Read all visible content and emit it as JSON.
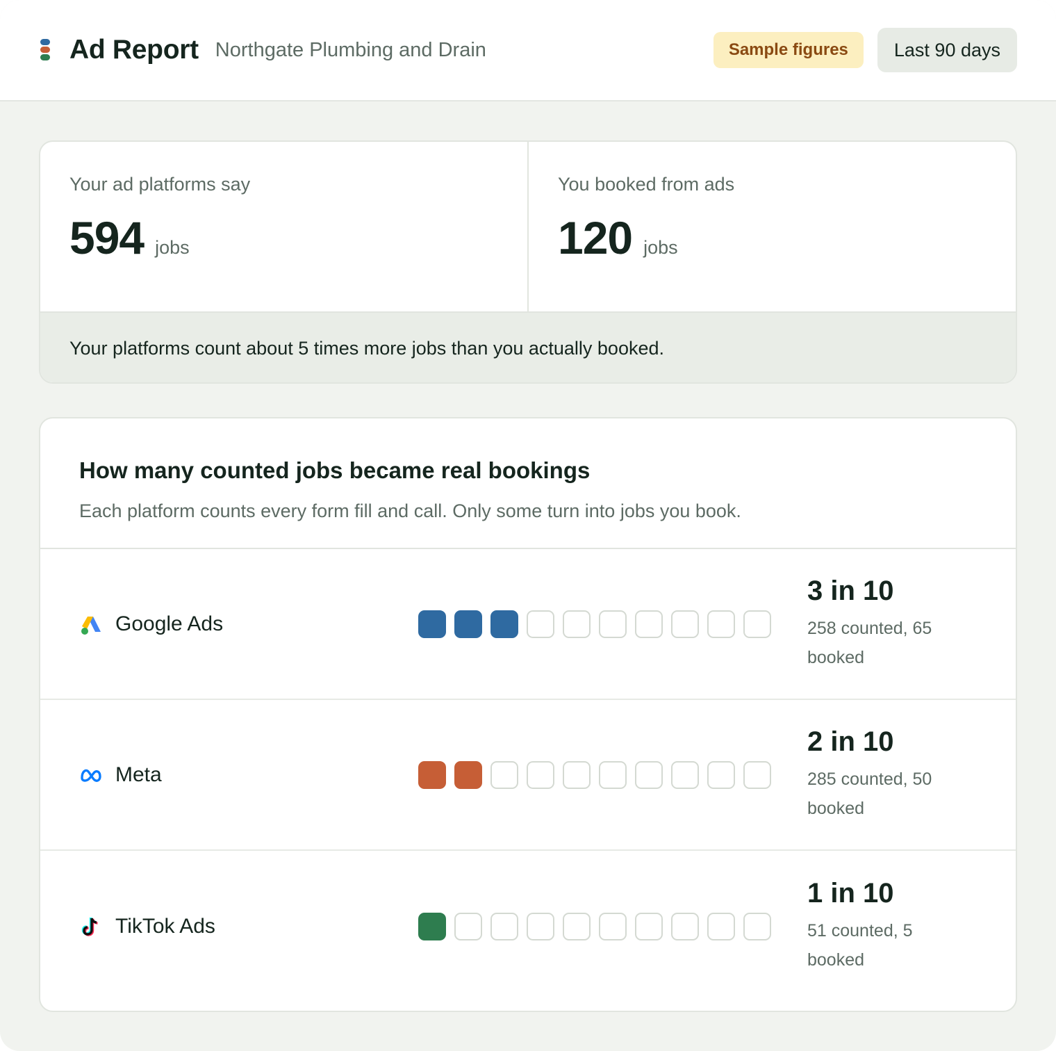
{
  "header": {
    "title": "Ad Report",
    "client": "Northgate Plumbing and Drain",
    "sample_badge": "Sample figures",
    "date_range": "Last 90 days"
  },
  "summary": {
    "platforms_label": "Your ad platforms say",
    "platforms_value": "594",
    "platforms_unit": "jobs",
    "booked_label": "You booked from ads",
    "booked_value": "120",
    "booked_unit": "jobs",
    "note": "Your platforms count about 5 times more jobs than you actually booked."
  },
  "breakdown": {
    "title": "How many counted jobs became real bookings",
    "subtitle": "Each platform counts every form fill and call. Only some turn into jobs you book.",
    "rows": [
      {
        "name": "Google Ads",
        "icon": "google-ads-icon",
        "filled": 3,
        "total": 10,
        "color": "#2f6aa1",
        "rate": "3 in 10",
        "detail": "258 counted, 65 booked"
      },
      {
        "name": "Meta",
        "icon": "meta-icon",
        "filled": 2,
        "total": 10,
        "color": "#c65e36",
        "rate": "2 in 10",
        "detail": "285 counted, 50 booked"
      },
      {
        "name": "TikTok Ads",
        "icon": "tiktok-icon",
        "filled": 1,
        "total": 10,
        "color": "#2e7d4f",
        "rate": "1 in 10",
        "detail": "51 counted, 5 booked"
      }
    ]
  }
}
